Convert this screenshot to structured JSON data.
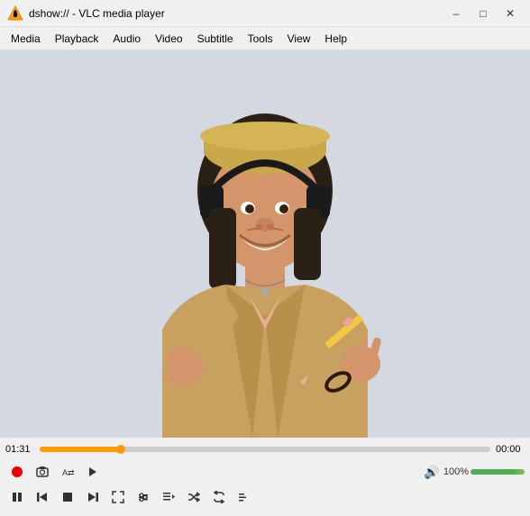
{
  "titleBar": {
    "icon": "vlc",
    "title": "dshow:// - VLC media player",
    "minBtn": "–",
    "maxBtn": "□",
    "closeBtn": "✕"
  },
  "menuBar": {
    "items": [
      "Media",
      "Playback",
      "Audio",
      "Video",
      "Subtitle",
      "Tools",
      "View",
      "Help"
    ]
  },
  "controls": {
    "currentTime": "01:31",
    "totalTime": "00:00",
    "volumeLabel": "100%",
    "progressPercent": 18
  },
  "buttons": {
    "record": "●",
    "snapshot": "⬛",
    "loop": "↺",
    "play": "▶",
    "pause": "⏸",
    "prevChapter": "⏮",
    "stop": "■",
    "nextChapter": "⏭",
    "fullscreen": "⛶",
    "extSettings": "|||",
    "playlist": "☰",
    "random": "⇄",
    "loop2": "↻",
    "moreEffects": "≡",
    "volume": "🔊"
  }
}
